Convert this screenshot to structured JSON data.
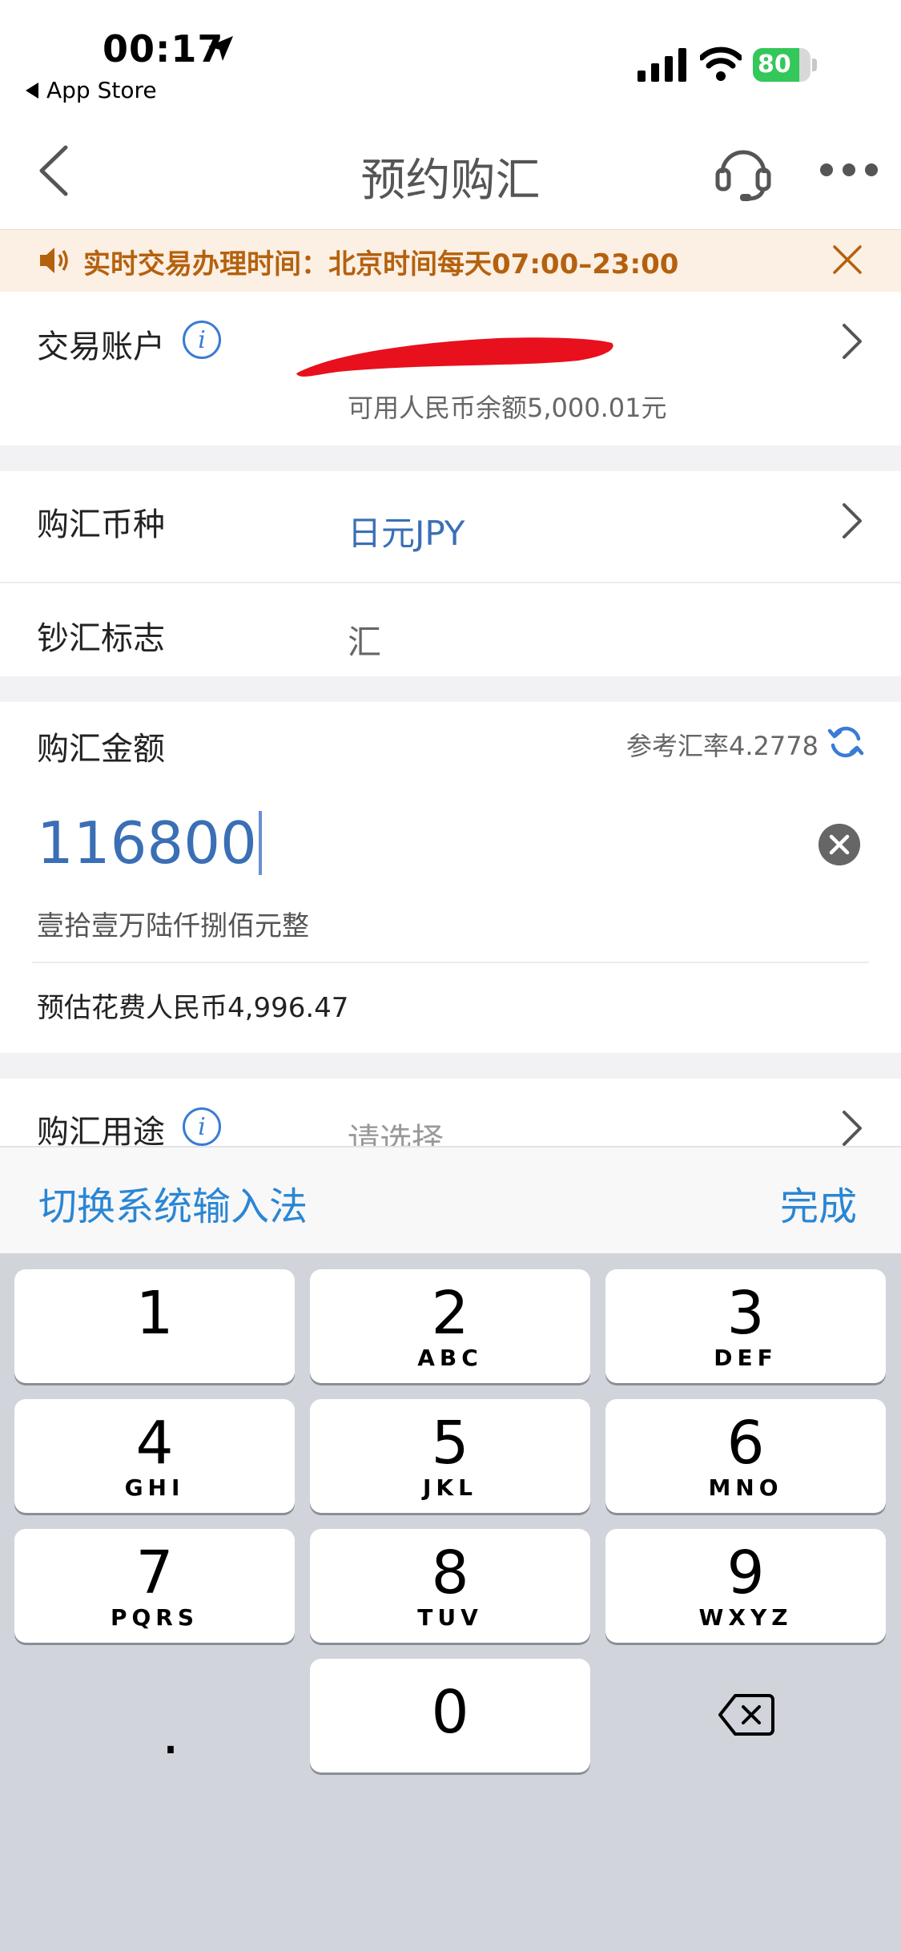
{
  "status_bar": {
    "time": "00:17",
    "back_app": "App Store",
    "battery": "80",
    "battery_level": 0.8
  },
  "nav": {
    "title": "预约购汇"
  },
  "notice": {
    "text": "实时交易办理时间：北京时间每天07:00–23:00"
  },
  "account": {
    "label": "交易账户",
    "balance": "可用人民币余额5,000.01元"
  },
  "currency": {
    "label": "购汇币种",
    "value": "日元JPY"
  },
  "cash_flag": {
    "label": "钞汇标志",
    "value": "汇"
  },
  "amount": {
    "label": "购汇金额",
    "rate": "参考汇率4.2778",
    "value": "116800",
    "words": "壹拾壹万陆仟捌佰元整",
    "estimate": "预估花费人民币4,996.47"
  },
  "purpose": {
    "label": "购汇用途",
    "placeholder": "请选择"
  },
  "accessory": {
    "switch_ime": "切换系统输入法",
    "done": "完成"
  },
  "keyboard": {
    "keys": [
      {
        "num": "1",
        "sub": ""
      },
      {
        "num": "2",
        "sub": "ABC"
      },
      {
        "num": "3",
        "sub": "DEF"
      },
      {
        "num": "4",
        "sub": "GHI"
      },
      {
        "num": "5",
        "sub": "JKL"
      },
      {
        "num": "6",
        "sub": "MNO"
      },
      {
        "num": "7",
        "sub": "PQRS"
      },
      {
        "num": "8",
        "sub": "TUV"
      },
      {
        "num": "9",
        "sub": "WXYZ"
      },
      {
        "num": "0",
        "sub": ""
      }
    ],
    "dot": "."
  },
  "colors": {
    "accent": "#3a6fb5",
    "link": "#2a86d4",
    "notice_text": "#b4610e",
    "notice_bg": "#fcefe3"
  }
}
